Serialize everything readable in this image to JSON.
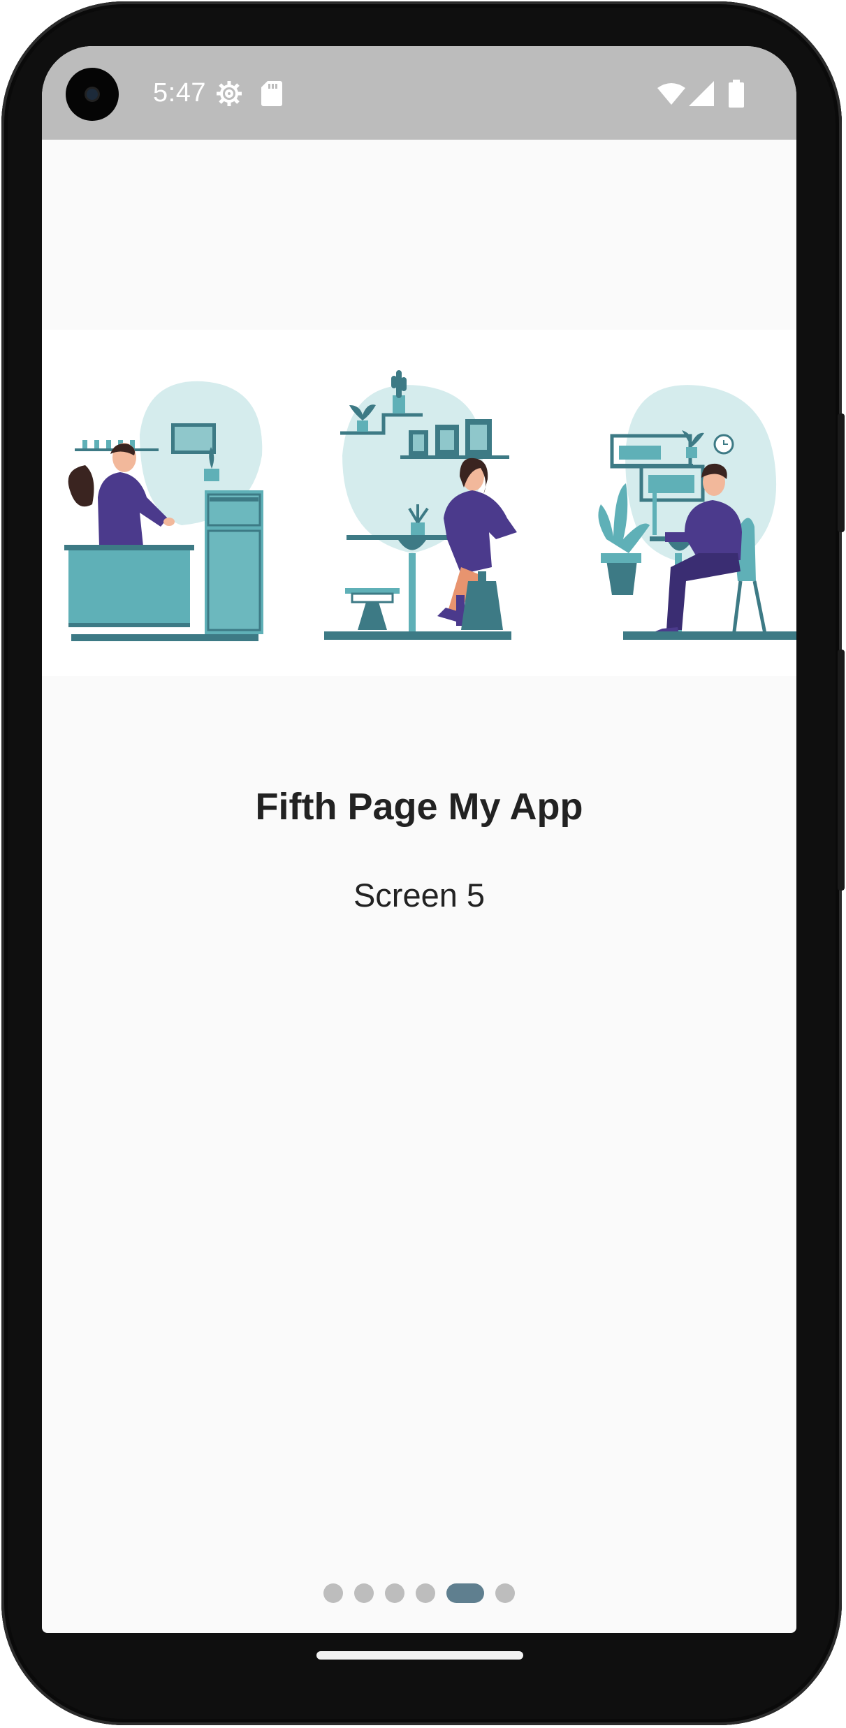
{
  "status_bar": {
    "time": "5:47",
    "left_icons": [
      "settings-icon",
      "sd-card-icon"
    ],
    "right_icons": [
      "wifi-icon",
      "cellular-signal-icon",
      "battery-icon"
    ]
  },
  "content": {
    "illustration": [
      "woman-at-kitchen-counter-scene",
      "woman-sitting-at-cafe-table-scene",
      "man-sitting-at-desk-scene"
    ],
    "title": "Fifth Page My App",
    "subtitle": "Screen 5"
  },
  "pager": {
    "page_count": 6,
    "current_page": 5
  },
  "colors": {
    "status_bar": "#bcbcbc",
    "background": "#fafafa",
    "accent_teal": "#5fb0b7",
    "dark_teal": "#3d7a85",
    "purple": "#4b3a8c",
    "indicator_active": "#5f7f8f",
    "indicator_inactive": "#bdbdbd"
  }
}
